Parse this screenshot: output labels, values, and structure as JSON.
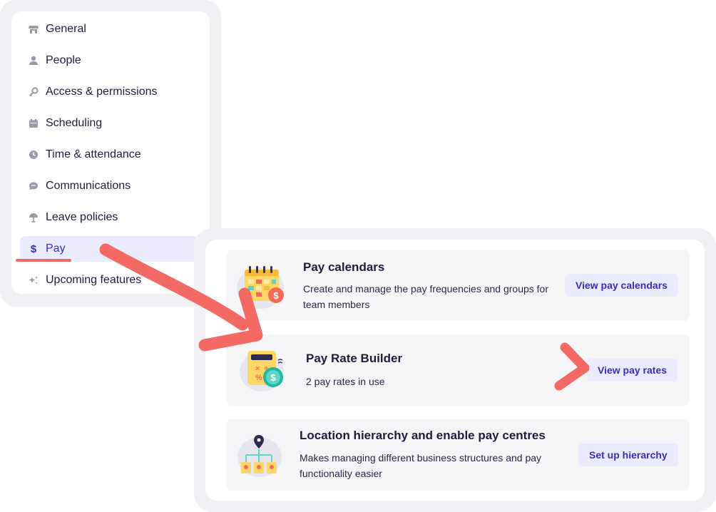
{
  "sidebar": {
    "items": [
      {
        "label": "General",
        "icon": "store-icon"
      },
      {
        "label": "People",
        "icon": "person-icon"
      },
      {
        "label": "Access & permissions",
        "icon": "key-icon"
      },
      {
        "label": "Scheduling",
        "icon": "calendar-icon"
      },
      {
        "label": "Time & attendance",
        "icon": "clock-icon"
      },
      {
        "label": "Communications",
        "icon": "chat-icon"
      },
      {
        "label": "Leave policies",
        "icon": "umbrella-icon"
      },
      {
        "label": "Pay",
        "icon": "dollar-icon",
        "active": true
      },
      {
        "label": "Upcoming features",
        "icon": "sparkle-icon"
      }
    ]
  },
  "pay": {
    "cards": [
      {
        "title": "Pay calendars",
        "description": "Create and manage the pay frequencies and groups for team members",
        "button": "View pay calendars"
      },
      {
        "title": "Pay Rate Builder",
        "description": "2 pay rates in use",
        "button": "View pay rates"
      },
      {
        "title": "Location hierarchy and enable pay centres",
        "description": "Makes managing different business structures and pay functionality easier",
        "button": "Set up hierarchy"
      }
    ]
  },
  "colors": {
    "accent": "#3b2db8",
    "active_bg": "#eceafd",
    "annotation": "#f26a63",
    "panel_bg": "#f1f1f5"
  }
}
